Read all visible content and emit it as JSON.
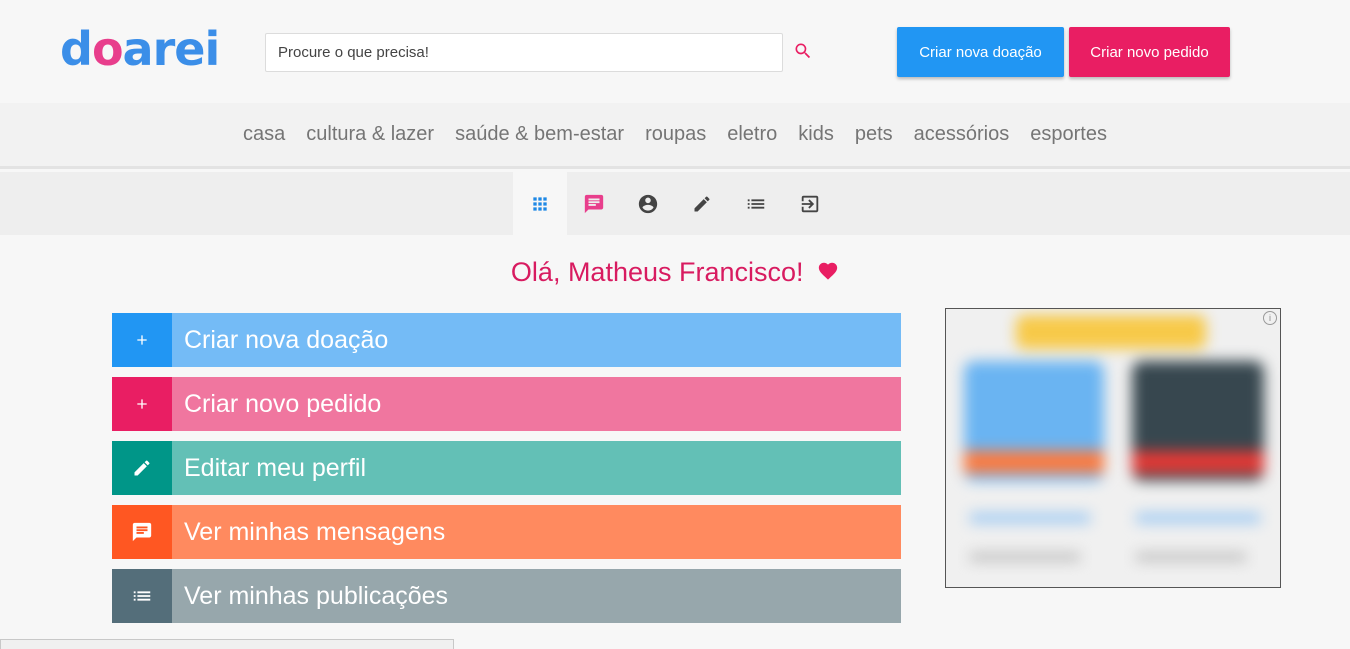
{
  "header": {
    "logo": {
      "part1": "d",
      "part2": "o",
      "part3": "arei"
    },
    "search": {
      "placeholder": "Procure o que precisa!",
      "icon": "search-icon"
    },
    "btn_donation": "Criar nova doação",
    "btn_request": "Criar novo pedido"
  },
  "categories": [
    "casa",
    "cultura & lazer",
    "saúde & bem-estar",
    "roupas",
    "eletro",
    "kids",
    "pets",
    "acessórios",
    "esportes"
  ],
  "iconbar": [
    {
      "icon": "grid-icon",
      "color": "#1e88e5"
    },
    {
      "icon": "message-icon",
      "color": "#e83e8c"
    },
    {
      "icon": "account-icon",
      "color": "#444444"
    },
    {
      "icon": "pencil-icon",
      "color": "#444444"
    },
    {
      "icon": "list-icon",
      "color": "#444444"
    },
    {
      "icon": "logout-icon",
      "color": "#444444"
    }
  ],
  "greeting": "Olá, Matheus Francisco!",
  "actions": [
    {
      "label": "Criar nova doação",
      "icon": "plus-icon",
      "icon_bg": "#2196f3",
      "bg": "#74bbf6"
    },
    {
      "label": "Criar novo pedido",
      "icon": "plus-icon",
      "icon_bg": "#e91e63",
      "bg": "#f0769f"
    },
    {
      "label": "Editar meu perfil",
      "icon": "pencil-icon",
      "icon_bg": "#009688",
      "bg": "#63c0b6"
    },
    {
      "label": "Ver minhas mensagens",
      "icon": "message-icon",
      "icon_bg": "#ff5722",
      "bg": "#ff8a5f"
    },
    {
      "label": "Ver minhas publicações",
      "icon": "list-icon",
      "icon_bg": "#546e7a",
      "bg": "#97a7ac"
    }
  ],
  "colors": {
    "brand_blue": "#3b8ee8",
    "brand_pink": "#e83e8c",
    "greeting": "#d81b60"
  }
}
